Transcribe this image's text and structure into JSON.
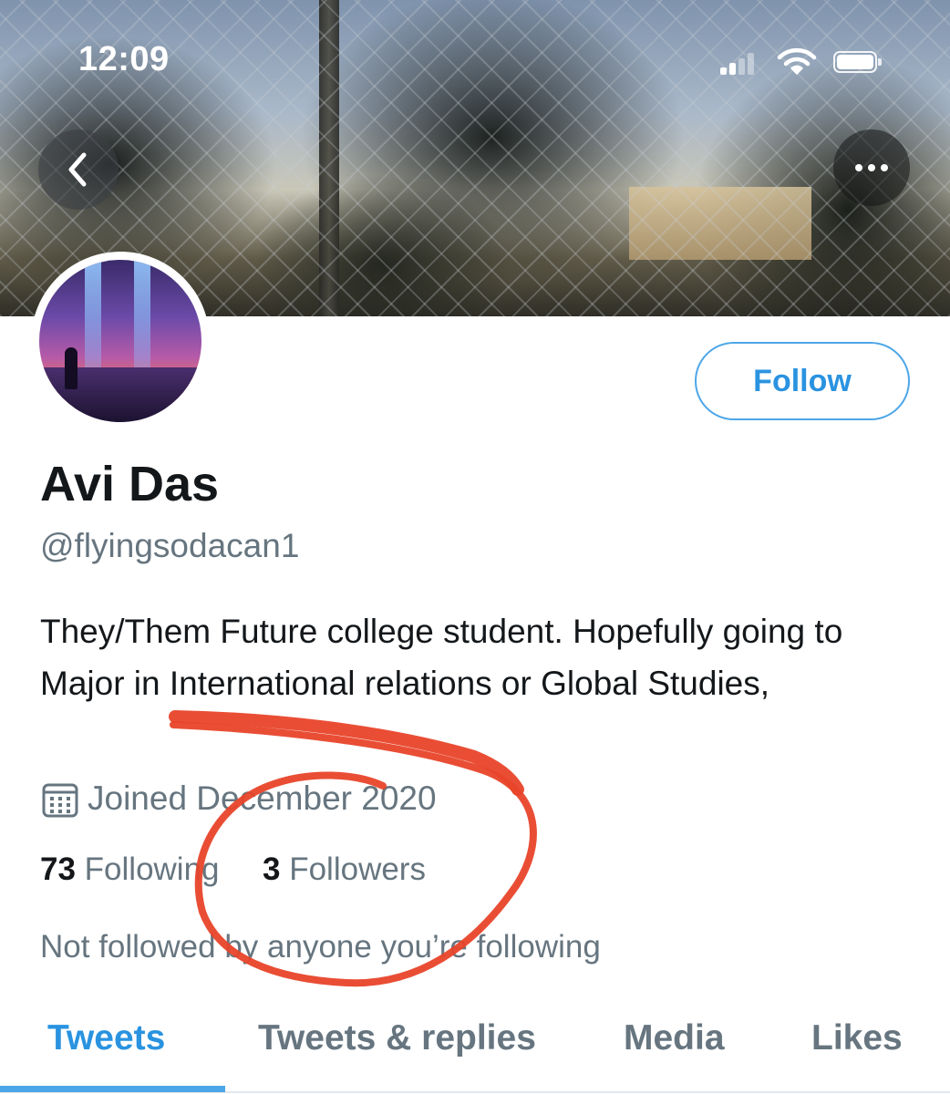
{
  "status_bar": {
    "time": "12:09",
    "icons": [
      "signal-icon",
      "wifi-icon",
      "battery-icon"
    ]
  },
  "header": {
    "back_icon": "chevron-left-icon",
    "more_icon": "more-horizontal-icon"
  },
  "profile": {
    "display_name": "Avi Das",
    "handle": "@flyingsodacan1",
    "bio": "They/Them Future college student. Hopefully going to Major in International relations or Global Studies,",
    "joined_icon": "calendar-icon",
    "joined": "Joined December 2020",
    "following_count": "73",
    "following_label": "Following",
    "followers_count": "3",
    "followers_label": "Followers",
    "social_context": "Not followed by anyone you’re following"
  },
  "actions": {
    "follow_label": "Follow"
  },
  "tabs": [
    {
      "label": "Tweets",
      "active": true
    },
    {
      "label": "Tweets & replies",
      "active": false
    },
    {
      "label": "Media",
      "active": false
    },
    {
      "label": "Likes",
      "active": false
    }
  ],
  "colors": {
    "accent": "#1DA1F2",
    "annotation": "#E8442A",
    "text_primary": "#14171A",
    "text_secondary": "#66757F"
  }
}
